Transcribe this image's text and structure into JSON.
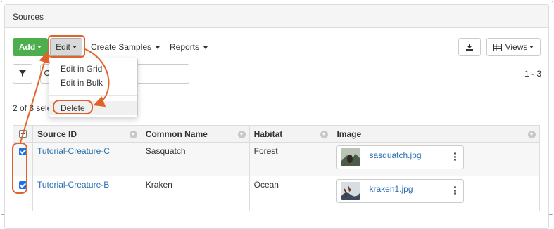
{
  "panel": {
    "title": "Sources"
  },
  "toolbar": {
    "add_label": "Add",
    "edit_label": "Edit",
    "create_samples_label": "Create Samples",
    "reports_label": "Reports",
    "views_label": "Views"
  },
  "edit_menu": {
    "items": [
      "Edit in Grid",
      "Edit in Bulk"
    ],
    "delete_label": "Delete"
  },
  "search": {
    "value": ""
  },
  "pagination": {
    "range": "1 - 3"
  },
  "selection": {
    "status": "2 of 3 sele"
  },
  "table": {
    "columns": [
      "Source ID",
      "Common Name",
      "Habitat",
      "Image"
    ],
    "rows": [
      {
        "checked": true,
        "source_id": "Tutorial-Creature-C",
        "common_name": "Sasquatch",
        "habitat": "Forest",
        "image": "sasquatch.jpg"
      },
      {
        "checked": true,
        "source_id": "Tutorial-Creature-B",
        "common_name": "Kraken",
        "habitat": "Ocean",
        "image": "kraken1.jpg"
      }
    ]
  },
  "colors": {
    "accent_annotation": "#e0622b",
    "add_button": "#4cae4c",
    "link": "#2a6fb0",
    "checkbox": "#1a73e8"
  },
  "icons": [
    "caret-down-icon",
    "download-icon",
    "grid-icon",
    "filter-icon",
    "search-icon",
    "sort-icon",
    "kebab-icon"
  ]
}
